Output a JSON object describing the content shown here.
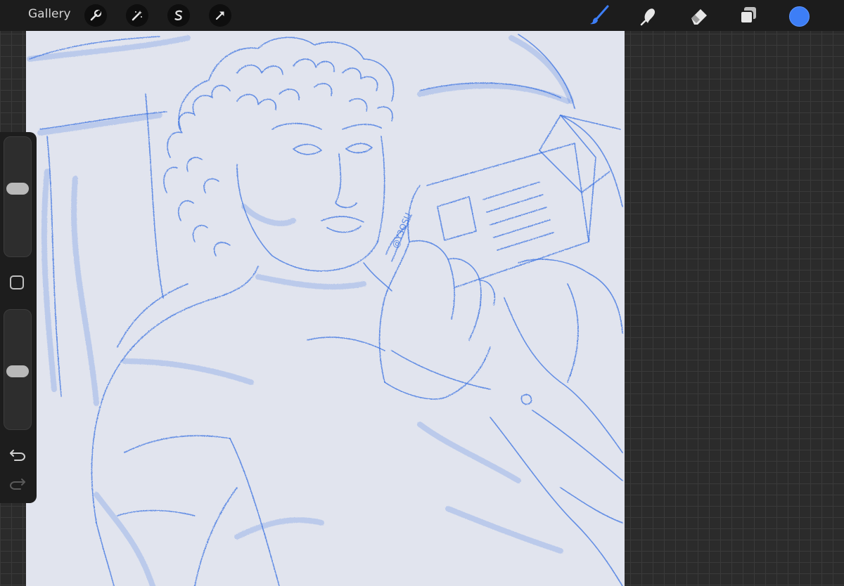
{
  "topbar": {
    "gallery_label": "Gallery",
    "left_tools": [
      "wrench-icon",
      "magic-wand-icon",
      "selection-s-icon",
      "transform-arrow-icon"
    ],
    "right_tools": [
      "brush-icon",
      "smudge-icon",
      "eraser-icon",
      "layers-icon"
    ],
    "active_tool": "brush",
    "current_color": "#3d7ef6"
  },
  "canvas": {
    "background": "#e1e4ee",
    "stroke_color": "#3a72e0",
    "signature_text": "@Y3OSU"
  },
  "sidebar": {
    "brush_size_level": 0.58,
    "opacity_level": 0.48,
    "controls": [
      "brush-size-slider",
      "modify-button",
      "opacity-slider",
      "undo-icon",
      "redo-icon"
    ]
  }
}
